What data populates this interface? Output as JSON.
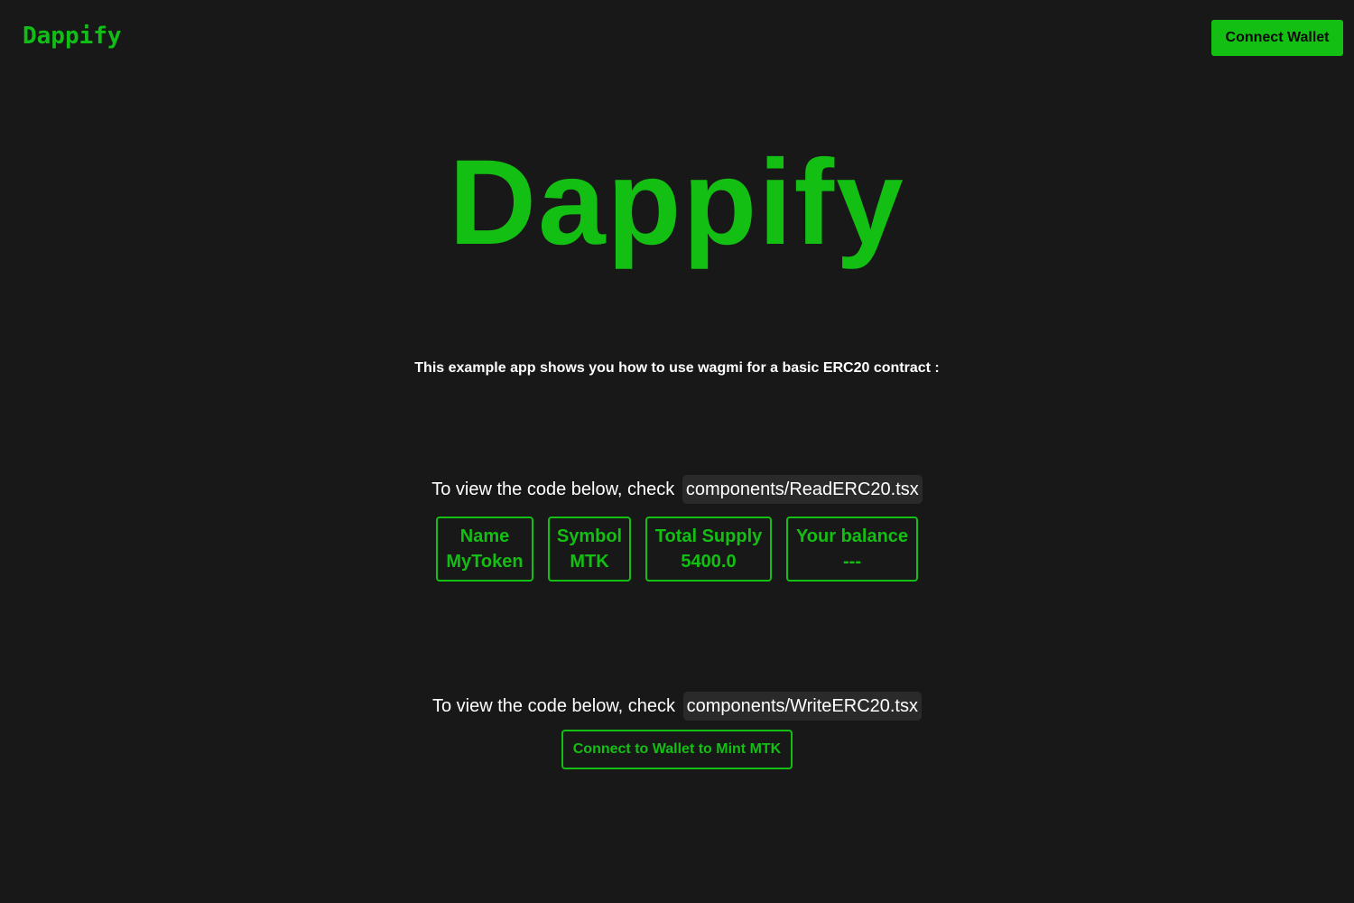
{
  "header": {
    "logo_text": "Dappify",
    "connect_button_label": "Connect Wallet"
  },
  "hero": {
    "title": "Dappify"
  },
  "intro_text": "This example app shows you how to use wagmi for a basic ERC20 contract :",
  "read_section": {
    "prefix": "To view the code below, check",
    "path": "components/ReadERC20.tsx",
    "stats": [
      {
        "label": "Name",
        "value": "MyToken"
      },
      {
        "label": "Symbol",
        "value": "MTK"
      },
      {
        "label": "Total Supply",
        "value": "5400.0"
      },
      {
        "label": "Your balance",
        "value": "---"
      }
    ]
  },
  "write_section": {
    "prefix": "To view the code below, check",
    "path": "components/WriteERC20.tsx",
    "mint_button_label": "Connect to Wallet to Mint MTK"
  },
  "colors": {
    "background": "#181818",
    "accent": "#13bf12",
    "code_bg": "#2a2a2a"
  }
}
